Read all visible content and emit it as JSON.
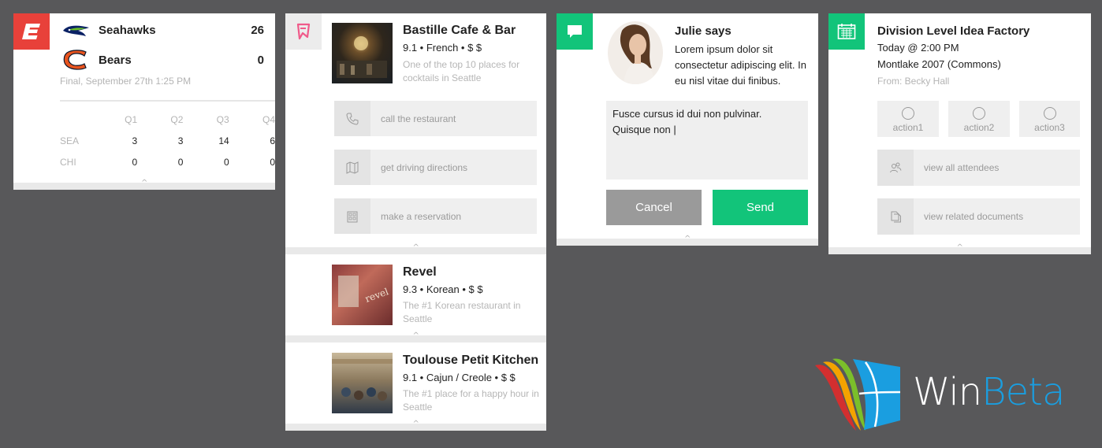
{
  "espn": {
    "team1": {
      "name": "Seahawks",
      "score": "26"
    },
    "team2": {
      "name": "Bears",
      "score": "0"
    },
    "status": "Final, September 27th 1:25 PM",
    "quarters": [
      "Q1",
      "Q2",
      "Q3",
      "Q4"
    ],
    "rows": [
      {
        "label": "SEA",
        "values": [
          "3",
          "3",
          "14",
          "6"
        ]
      },
      {
        "label": "CHI",
        "values": [
          "0",
          "0",
          "0",
          "0"
        ]
      }
    ]
  },
  "foursquare": {
    "top": {
      "name": "Bastille Cafe & Bar",
      "meta": "9.1 • French • $ $",
      "desc": "One of the top 10 places for cocktails in Seattle",
      "actions": [
        {
          "label": "call the restaurant",
          "icon": "phone-icon"
        },
        {
          "label": "get driving directions",
          "icon": "map-icon"
        },
        {
          "label": "make a reservation",
          "icon": "building-icon"
        }
      ]
    },
    "second": {
      "name": "Revel",
      "meta": "9.3 • Korean • $ $",
      "desc": "The #1 Korean restaurant in Seattle"
    },
    "third": {
      "name": "Toulouse Petit Kitchen",
      "meta": "9.1 • Cajun / Creole • $ $",
      "desc": "The #1 place for a happy hour in Seattle"
    }
  },
  "message": {
    "sender": "Julie says",
    "body": "Lorem ipsum dolor sit consectetur adipiscing elit. In eu nisl vitae dui finibus.",
    "reply": "Fusce cursus id dui non pulvinar. Quisque non |",
    "cancel": "Cancel",
    "send": "Send"
  },
  "calendar": {
    "title": "Division Level Idea Factory",
    "time": "Today @ 2:00 PM",
    "location": "Montlake 2007 (Commons)",
    "from": "From: Becky Hall",
    "actions": [
      "action1",
      "action2",
      "action3"
    ],
    "links": [
      {
        "label": "view all attendees",
        "icon": "people-icon"
      },
      {
        "label": "view related documents",
        "icon": "documents-icon"
      }
    ]
  },
  "brand": {
    "win": "Win",
    "beta": "Beta"
  },
  "colors": {
    "espn": "#e8413a",
    "foursquare": "#f05a8a",
    "green": "#12c47a",
    "cancel": "#9a9a9a",
    "winblue": "#1a9ee0"
  }
}
